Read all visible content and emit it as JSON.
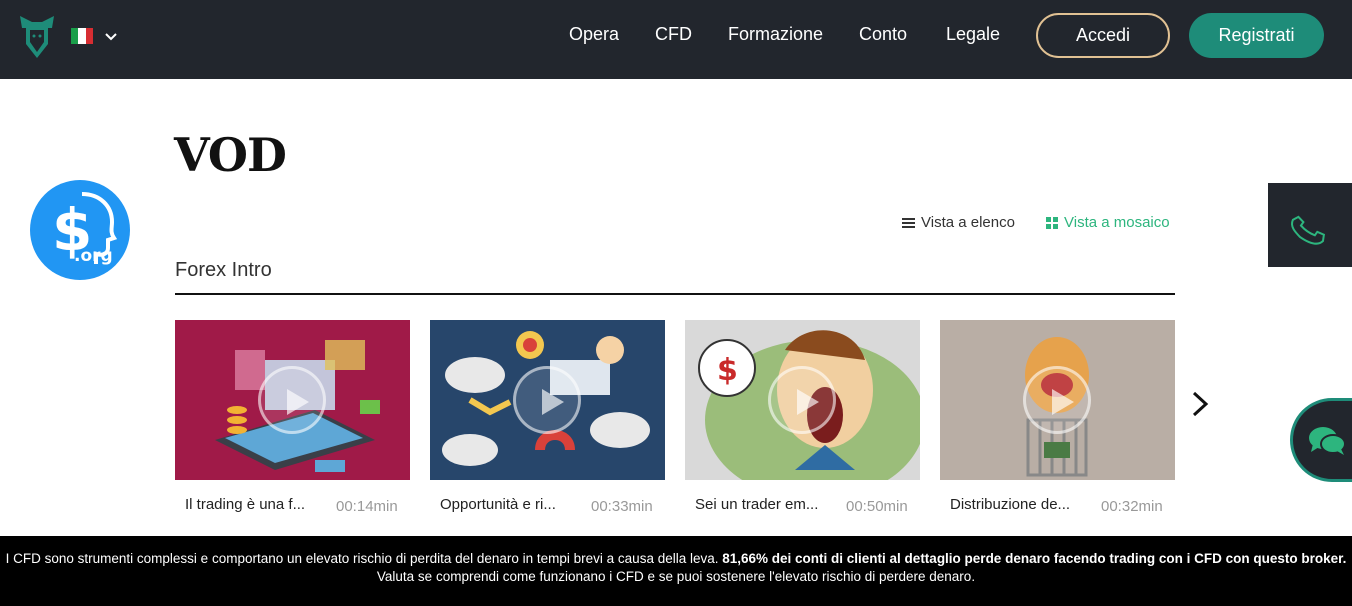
{
  "header": {
    "nav": [
      "Opera",
      "CFD",
      "Formazione",
      "Conto",
      "Legale"
    ],
    "login_label": "Accedi",
    "register_label": "Registrati",
    "language_flag": "flag-icon-italy"
  },
  "page": {
    "title": "VOD",
    "view_list_label": "Vista a elenco",
    "view_grid_label": "Vista a mosaico",
    "section_title": "Forex Intro"
  },
  "videos": [
    {
      "title": "Il trading è una f...",
      "duration": "00:14min"
    },
    {
      "title": "Opportunità e ri...",
      "duration": "00:33min"
    },
    {
      "title": "Sei un trader em...",
      "duration": "00:50min"
    },
    {
      "title": "Distribuzione de...",
      "duration": "00:32min"
    }
  ],
  "side_logo_text": ".org",
  "disclaimer": {
    "part1": "I CFD sono strumenti complessi e comportano un elevato rischio di perdita del denaro in tempi brevi a causa della leva. ",
    "bold": "81,66% dei conti di clienti al dettaglio perde denaro facendo trading con i CFD con questo broker.",
    "part2": " Valuta se comprendi come funzionano i CFD e se puoi sostenere l'elevato rischio di perdere denaro."
  },
  "colors": {
    "header_bg": "#22262d",
    "accent_green": "#1e8c79",
    "accent_gold": "#e1c193",
    "grid_active": "#2db57e"
  }
}
